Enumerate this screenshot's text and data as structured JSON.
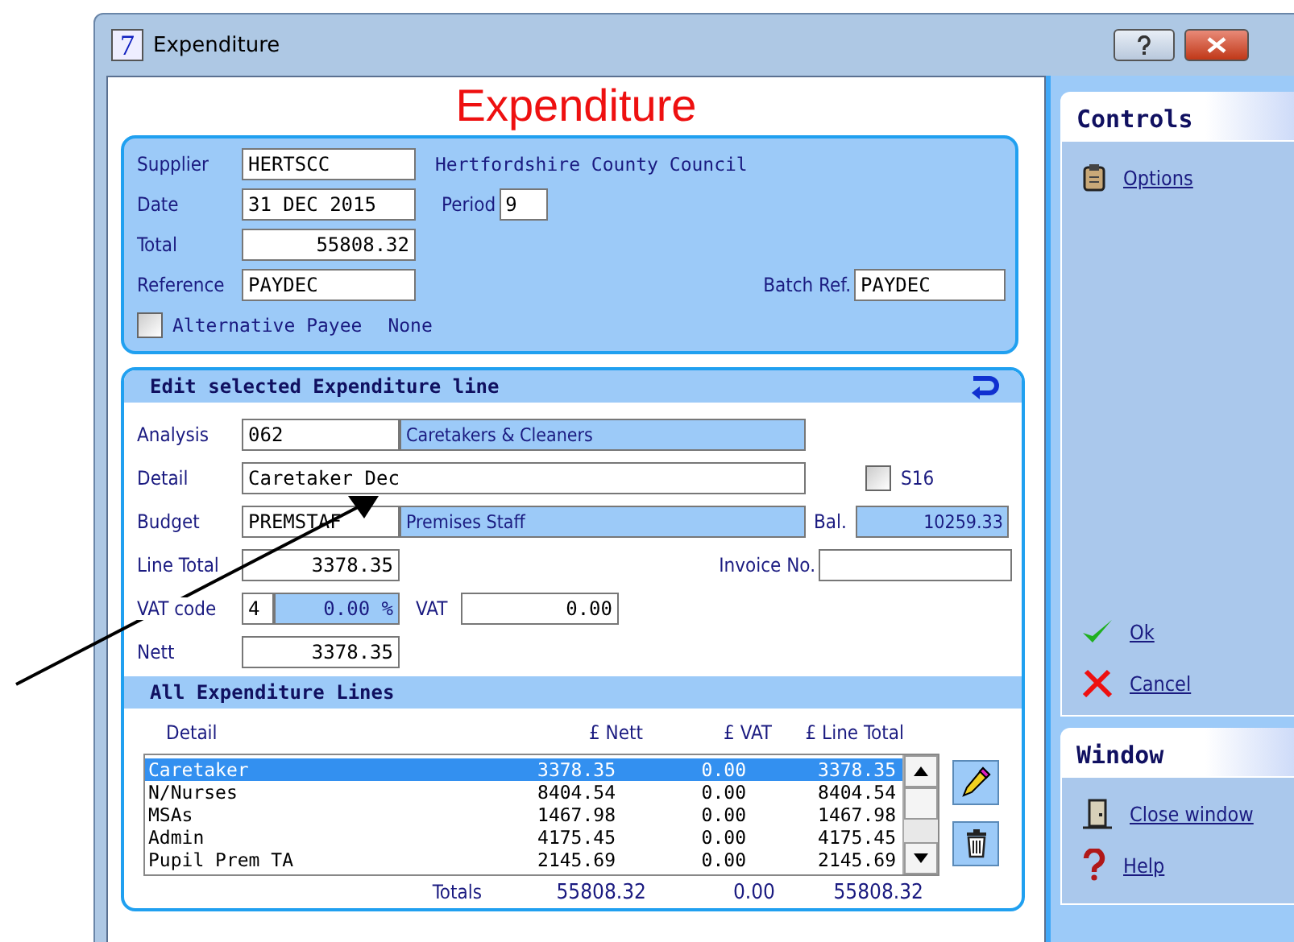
{
  "window": {
    "title": "Expenditure",
    "app_icon": "7"
  },
  "heading": "Expenditure",
  "header": {
    "supplier": {
      "label": "Supplier",
      "code": "HERTSCC",
      "name": "Hertfordshire County Council"
    },
    "date": {
      "label": "Date",
      "value": "31 DEC 2015"
    },
    "period": {
      "label": "Period",
      "value": "9"
    },
    "total": {
      "label": "Total",
      "value": "55808.32"
    },
    "reference": {
      "label": "Reference",
      "value": "PAYDEC"
    },
    "batch_ref": {
      "label": "Batch Ref.",
      "value": "PAYDEC"
    },
    "alternative_payee": {
      "label": "Alternative Payee",
      "checked": false,
      "value": "None"
    }
  },
  "edit_line": {
    "title": "Edit selected Expenditure line",
    "analysis": {
      "label": "Analysis",
      "code": "062",
      "name": "Caretakers & Cleaners"
    },
    "detail": {
      "label": "Detail",
      "value": "Caretaker Dec"
    },
    "s16": {
      "label": "S16",
      "checked": false
    },
    "budget": {
      "label": "Budget",
      "code": "PREMSTAF",
      "name": "Premises Staff"
    },
    "balance": {
      "label": "Bal.",
      "value": "10259.33"
    },
    "line_total": {
      "label": "Line Total",
      "value": "3378.35"
    },
    "invoice_no": {
      "label": "Invoice No."
    },
    "vat_code": {
      "label": "VAT code",
      "code": "4",
      "rate": "0.00 %"
    },
    "vat": {
      "label": "VAT",
      "value": "0.00"
    },
    "nett": {
      "label": "Nett",
      "value": "3378.35"
    }
  },
  "lines": {
    "title": "All Expenditure Lines",
    "columns": [
      "Detail",
      "£ Nett",
      "£ VAT",
      "£ Line Total"
    ],
    "rows": [
      {
        "cells": [
          "Caretaker",
          "3378.35",
          "0.00",
          "3378.35"
        ],
        "selected": true
      },
      {
        "cells": [
          "N/Nurses",
          "8404.54",
          "0.00",
          "8404.54"
        ],
        "selected": false
      },
      {
        "cells": [
          "MSAs",
          "1467.98",
          "0.00",
          "1467.98"
        ],
        "selected": false
      },
      {
        "cells": [
          "Admin",
          "4175.45",
          "0.00",
          "4175.45"
        ],
        "selected": false
      },
      {
        "cells": [
          "Pupil Prem TA",
          "2145.69",
          "0.00",
          "2145.69"
        ],
        "selected": false
      }
    ],
    "totals": {
      "label": "Totals",
      "values": [
        "55808.32",
        "0.00",
        "55808.32"
      ]
    }
  },
  "controls": {
    "title": "Controls",
    "top": [
      {
        "label": "Options",
        "kind": "options"
      }
    ],
    "bottom": [
      {
        "label": "Ok",
        "kind": "ok"
      },
      {
        "label": "Cancel",
        "kind": "cancel"
      }
    ]
  },
  "window_panel": {
    "title": "Window",
    "items": [
      {
        "label": "Close window",
        "kind": "close"
      },
      {
        "label": "Help",
        "kind": "help"
      }
    ]
  }
}
